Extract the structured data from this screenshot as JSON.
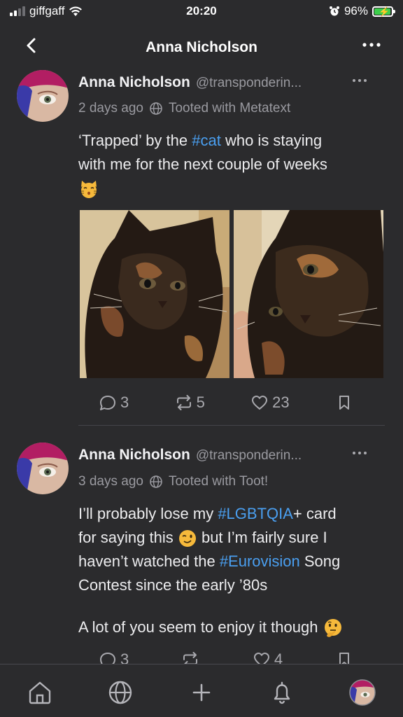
{
  "status_bar": {
    "carrier": "giffgaff",
    "time": "20:20",
    "battery_percent": "96%",
    "battery_level": 0.96
  },
  "nav": {
    "title": "Anna Nicholson"
  },
  "posts": [
    {
      "name": "Anna Nicholson",
      "handle": "@transponderin...",
      "time": "2 days ago",
      "via": "Tooted with Metatext",
      "content": {
        "line1_a": "‘Trapped’ by the ",
        "line1_tag": "#cat",
        "line1_b": " who is staying",
        "line2": "with me for the next couple of weeks"
      },
      "replies": "3",
      "boosts": "5",
      "favourites": "23"
    },
    {
      "name": "Anna Nicholson",
      "handle": "@transponderin...",
      "time": "3 days ago",
      "via": "Tooted with Toot!",
      "content": {
        "line1_a": "I’ll probably lose my ",
        "line1_tag": "#LGBTQIA",
        "line1_b": "+ card",
        "line2_a": "for saying this ",
        "line2_b": " but I’m fairly sure I",
        "line3_a": "haven’t watched the ",
        "line3_tag": "#Eurovision",
        "line3_b": " Song",
        "line4": "Contest since the early ’80s",
        "line5": "A lot of you seem to enjoy it though "
      },
      "replies": "3",
      "favourites": "4"
    }
  ],
  "colors": {
    "background": "#2b2b2d",
    "hashtag": "#4a9ff0",
    "secondary_text": "#9a9aa0",
    "battery_fill": "#3ecf4c"
  },
  "icons": {
    "tabbar": [
      "home-icon",
      "globe-icon",
      "plus-icon",
      "bell-icon",
      "profile-avatar"
    ]
  }
}
